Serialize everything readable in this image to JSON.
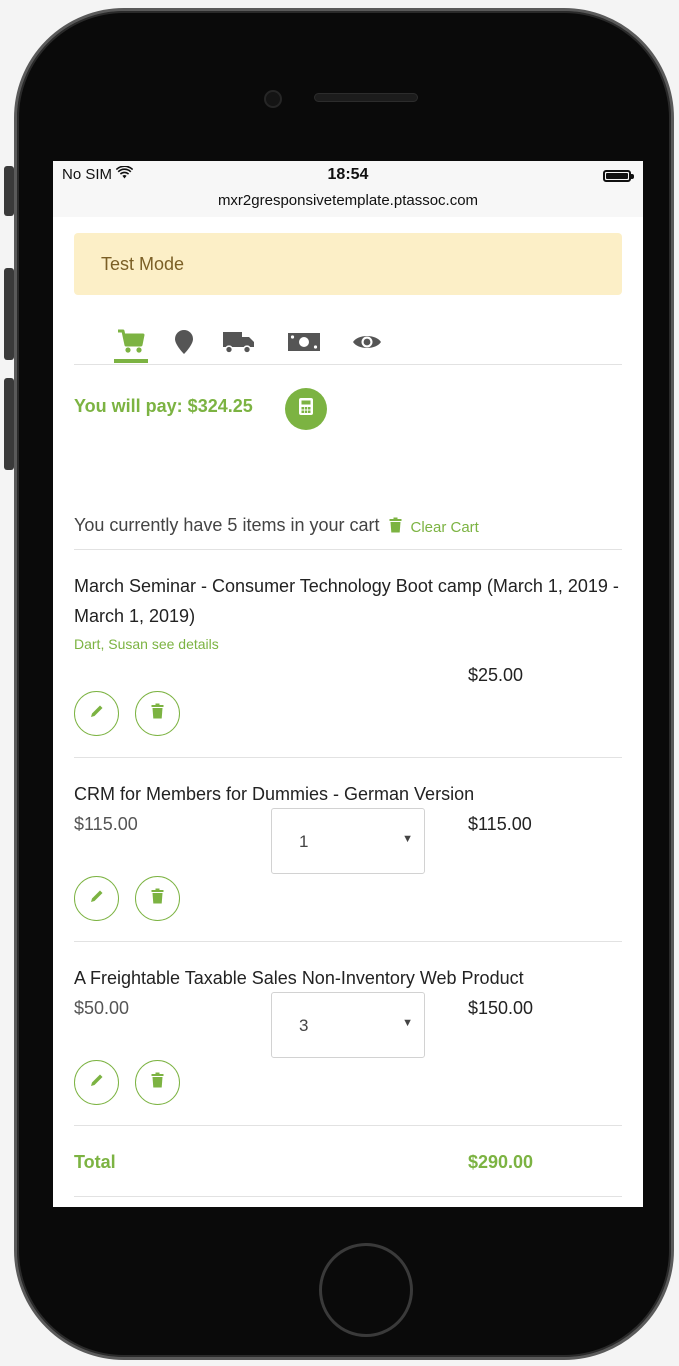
{
  "status_bar": {
    "carrier": "No SIM",
    "time": "18:54",
    "url": "mxr2gresponsivetemplate.ptassoc.com"
  },
  "test_mode": "Test Mode",
  "checkout_steps": [
    {
      "icon": "cart-icon",
      "active": true
    },
    {
      "icon": "map-marker-icon",
      "active": false
    },
    {
      "icon": "truck-icon",
      "active": false
    },
    {
      "icon": "money-icon",
      "active": false
    },
    {
      "icon": "eye-icon",
      "active": false
    }
  ],
  "payment": {
    "label": "You will pay: $324.25",
    "calculator_icon": "calculator-icon"
  },
  "cart": {
    "summary": "You currently have 5 items in your cart",
    "clear_label": "Clear Cart"
  },
  "items": [
    {
      "name": "March Seminar - Consumer Technology Boot camp (March 1, 2019 - March 1, 2019)",
      "attendee": "Dart, Susan",
      "details_link": "see details",
      "line_total": "$25.00"
    },
    {
      "name": "CRM for Members for Dummies - German Version",
      "unit_price": "$115.00",
      "quantity": "1",
      "line_total": "$115.00"
    },
    {
      "name": "A Freightable Taxable Sales Non-Inventory Web Product",
      "unit_price": "$50.00",
      "quantity": "3",
      "line_total": "$150.00"
    }
  ],
  "total": {
    "label": "Total",
    "value": "$290.00"
  },
  "colors": {
    "accent": "#7cb342",
    "test_mode_bg": "#fcefc7",
    "test_mode_text": "#7b5f26"
  }
}
